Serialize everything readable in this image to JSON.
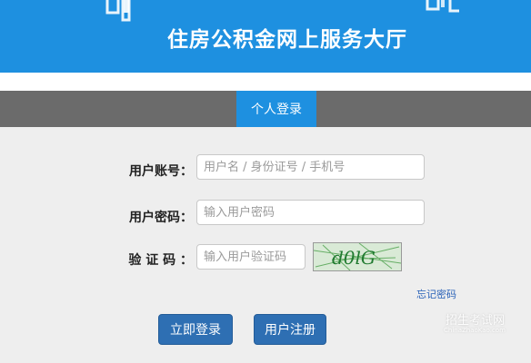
{
  "header": {
    "title": "住房公积金网上服务大厅"
  },
  "tabs": {
    "active_label": "个人登录"
  },
  "form": {
    "account_label": "用户账号：",
    "account_placeholder": "用户名 / 身份证号 / 手机号",
    "password_label": "用户密码：",
    "password_placeholder": "输入用户密码",
    "captcha_label": "验 证 码 ：",
    "captcha_placeholder": "输入用户验证码",
    "captcha_text": "d0lG",
    "forgot_password": "忘记密码"
  },
  "buttons": {
    "login": "立即登录",
    "register": "用户注册"
  },
  "watermark": {
    "text": "招生考试网",
    "url": "ChinaZhaoKao.com"
  },
  "colors": {
    "banner": "#1e90e0",
    "tabbar": "#6b6b6b",
    "button": "#2e6fb3",
    "link": "#2a62b8"
  }
}
